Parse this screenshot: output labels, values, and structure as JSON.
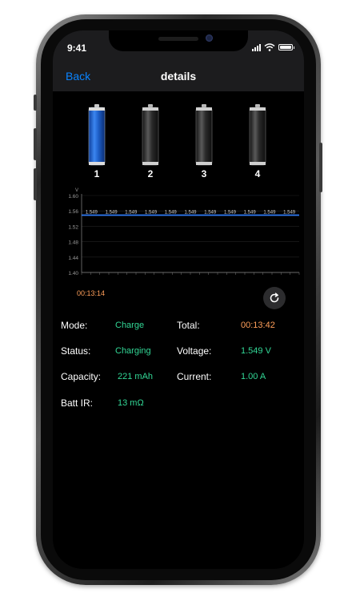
{
  "status_bar": {
    "time": "9:41"
  },
  "nav": {
    "back_label": "Back",
    "title": "details"
  },
  "cells": [
    {
      "label": "1",
      "state": "active",
      "color": "#1e5fc8"
    },
    {
      "label": "2",
      "state": "inactive",
      "color": "#3a3a3a"
    },
    {
      "label": "3",
      "state": "inactive",
      "color": "#3a3a3a"
    },
    {
      "label": "4",
      "state": "inactive",
      "color": "#3a3a3a"
    }
  ],
  "chart_data": {
    "type": "line",
    "ylabel": "V",
    "ylim": [
      1.4,
      1.6
    ],
    "yticks": [
      "1.60",
      "1.56",
      "1.52",
      "1.48",
      "1.44",
      "1.40"
    ],
    "series": [
      {
        "values": [
          1.549,
          1.549,
          1.549,
          1.549,
          1.549,
          1.549,
          1.549,
          1.549,
          1.549,
          1.549,
          1.549
        ],
        "point_labels": [
          "1.549",
          "1.549",
          "1.549",
          "1.549",
          "1.549",
          "1.549",
          "1.549",
          "1.549",
          "1.549",
          "1.549",
          "1.549"
        ],
        "color": "#2f7bf6"
      }
    ],
    "grid": true
  },
  "elapsed_time": "00:13:14",
  "info": {
    "mode_label": "Mode:",
    "mode_value": "Charge",
    "total_label": "Total:",
    "total_value": "00:13:42",
    "status_label": "Status:",
    "status_value": "Charging",
    "voltage_label": "Voltage:",
    "voltage_value": "1.549 V",
    "capacity_label": "Capacity:",
    "capacity_value": "221 mAh",
    "current_label": "Current:",
    "current_value": "1.00 A",
    "ir_label": "Batt IR:",
    "ir_value": "13 mΩ"
  },
  "colors": {
    "accent": "#0a84ff",
    "value_green": "#32d796",
    "value_orange": "#ff9f5a",
    "chart_line": "#2f7bf6"
  },
  "icons": {
    "refresh": "refresh-icon",
    "signal": "cellular-signal-icon",
    "wifi": "wifi-icon",
    "battery": "battery-icon"
  }
}
